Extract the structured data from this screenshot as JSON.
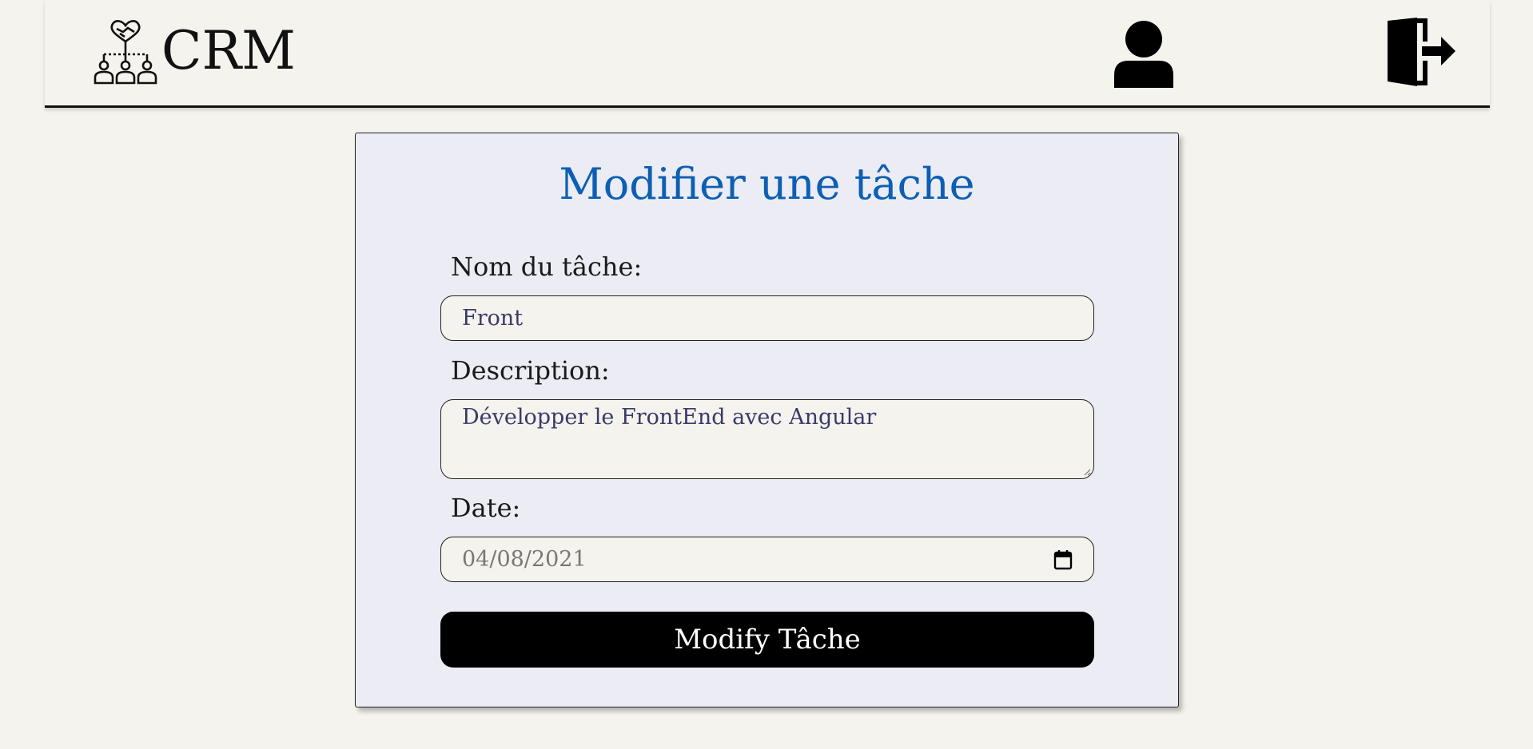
{
  "header": {
    "app_name": "CRM",
    "logo_icon": "team-handshake-icon",
    "user_icon": "user-icon",
    "logout_icon": "logout-icon"
  },
  "form": {
    "title": "Modifier une tâche",
    "name_label": "Nom du tâche:",
    "name_value": "Front",
    "description_label": "Description:",
    "description_value": "Développer le FrontEnd avec Angular",
    "date_label": "Date:",
    "date_value": "04/08/2021",
    "date_icon": "calendar-icon",
    "submit_label": "Modify Tâche"
  },
  "colors": {
    "background": "#f4f3ed",
    "card": "#ebecf4",
    "title": "#0c5fb3",
    "button": "#000000"
  }
}
